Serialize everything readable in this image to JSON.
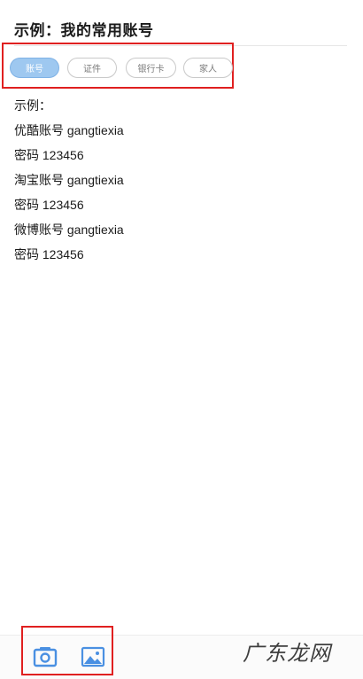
{
  "header": {
    "title": "示例：我的常用账号"
  },
  "tags": [
    {
      "label": "账号",
      "active": true
    },
    {
      "label": "证件",
      "active": false
    },
    {
      "label": "银行卡",
      "active": false
    },
    {
      "label": "家人",
      "active": false
    }
  ],
  "content": {
    "lines": [
      "示例：",
      "优酷账号 gangtiexia",
      "密码 123456",
      "淘宝账号 gangtiexia",
      "密码 123456",
      "微博账号 gangtiexia",
      "密码 123456"
    ]
  },
  "toolbar": {
    "camera_icon": "camera-icon",
    "image_icon": "image-icon",
    "accent_color": "#4a90e2"
  },
  "watermark": {
    "text": "广东龙网"
  }
}
